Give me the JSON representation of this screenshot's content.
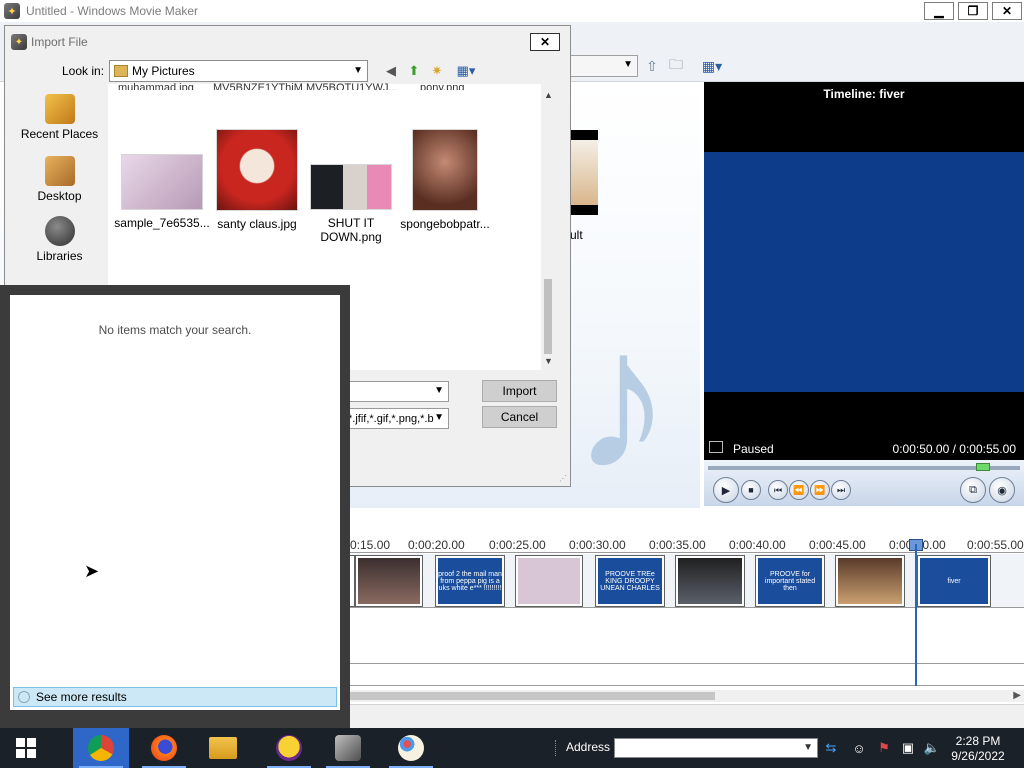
{
  "window": {
    "title": "Untitled - Windows Movie Maker",
    "minimize": "▁",
    "maximize": "❐",
    "close": "✕"
  },
  "import_dialog": {
    "title": "Import File",
    "close": "✕",
    "look_in_label": "Look in:",
    "look_in_value": "My Pictures",
    "places": [
      {
        "label": "Recent Places"
      },
      {
        "label": "Desktop"
      },
      {
        "label": "Libraries"
      }
    ],
    "cut_labels": [
      "muhammad.jpg",
      "MV5BNZE1YThiM",
      "MV5BOTU1YWJ...",
      "pony.png"
    ],
    "files": [
      {
        "name": "sample_7e6535..."
      },
      {
        "name": "santy claus.jpg"
      },
      {
        "name": "SHUT IT DOWN.png"
      },
      {
        "name": "spongebobpatr..."
      }
    ],
    "filename_value": "",
    "filetype_value": "*.jfif,*.gif,*.png,*.b",
    "import_button": "Import",
    "cancel_button": "Cancel"
  },
  "search_panel": {
    "message": "No items match your search.",
    "see_more": "See more results"
  },
  "collection": {
    "clip_label": "ult"
  },
  "preview": {
    "title": "Timeline: fiver",
    "status": "Paused",
    "time": "0:00:50.00 / 0:00:55.00",
    "seek_position": 0.9
  },
  "timeline": {
    "ticks": [
      "0:15.00",
      "0:00:20.00",
      "0:00:25.00",
      "0:00:30.00",
      "0:00:35.00",
      "0:00:40.00",
      "0:00:45.00",
      "0:00:50.00",
      "0:00:55.00"
    ],
    "clips": [
      {
        "text": ""
      },
      {
        "text": ""
      },
      {
        "text": "proof 2 the mail man from peppa pig is a uks white e*** !!!!!!!!!"
      },
      {
        "text": ""
      },
      {
        "text": "PROOVE TREe KING DROOPY UNEAN CHARLES"
      },
      {
        "text": ""
      },
      {
        "text": "PROOVE for important stated then"
      },
      {
        "text": ""
      },
      {
        "text": "fiver"
      }
    ]
  },
  "taskbar": {
    "address_label": "Address",
    "address_value": "",
    "time": "2:28 PM",
    "date": "9/26/2022",
    "apps": [
      "Chrome",
      "Firefox",
      "File Explorer",
      "Yahoo Messenger",
      "Windows Movie Maker",
      "Paint"
    ]
  },
  "colors": {
    "preview_blue": "#0d3c8a",
    "timeline_clip_blue": "#1a4d9c",
    "taskbar": "#1b2128",
    "active_app": "#2e67c8",
    "see_more_bg": "#cce8f6"
  }
}
